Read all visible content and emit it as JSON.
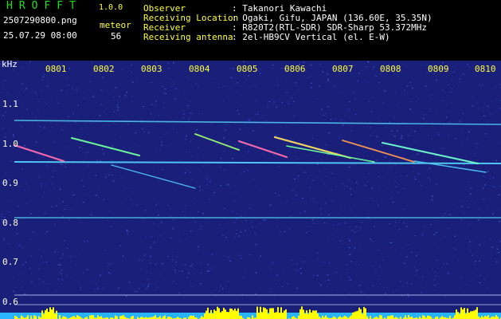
{
  "header": {
    "brand": "HROFFT",
    "version": "1.0.0",
    "filename": "2507290800.png",
    "timestamp": "25.07.29 08:00",
    "meteor_label": "meteor",
    "meteor_count": "56",
    "meta": [
      {
        "key": "Observer",
        "value": ": Takanori Kawachi"
      },
      {
        "key": "Receiving Location",
        "value": ": Ogaki, Gifu, JAPAN (136.60E, 35.35N)"
      },
      {
        "key": "Receiver",
        "value": ": R820T2(RTL-SDR) SDR-Sharp 53.372MHz"
      },
      {
        "key": "Receiving antenna",
        "value": ": 2el-HB9CV Vertical (el. E-W)"
      }
    ]
  },
  "axis": {
    "unit": "kHz",
    "y_ticks": [
      "1.1",
      "1.0",
      "0.9",
      "0.8",
      "0.7",
      "0.6"
    ],
    "x_ticks": [
      "0801",
      "0802",
      "0803",
      "0804",
      "0805",
      "0806",
      "0807",
      "0808",
      "0809",
      "0810"
    ]
  },
  "colors": {
    "background": "#1a1f7a",
    "carrier": "#4fc6f0",
    "echo_hot": "#ff4fa0",
    "level_bar": "#ffff00",
    "level_base": "#28b4ff"
  }
}
